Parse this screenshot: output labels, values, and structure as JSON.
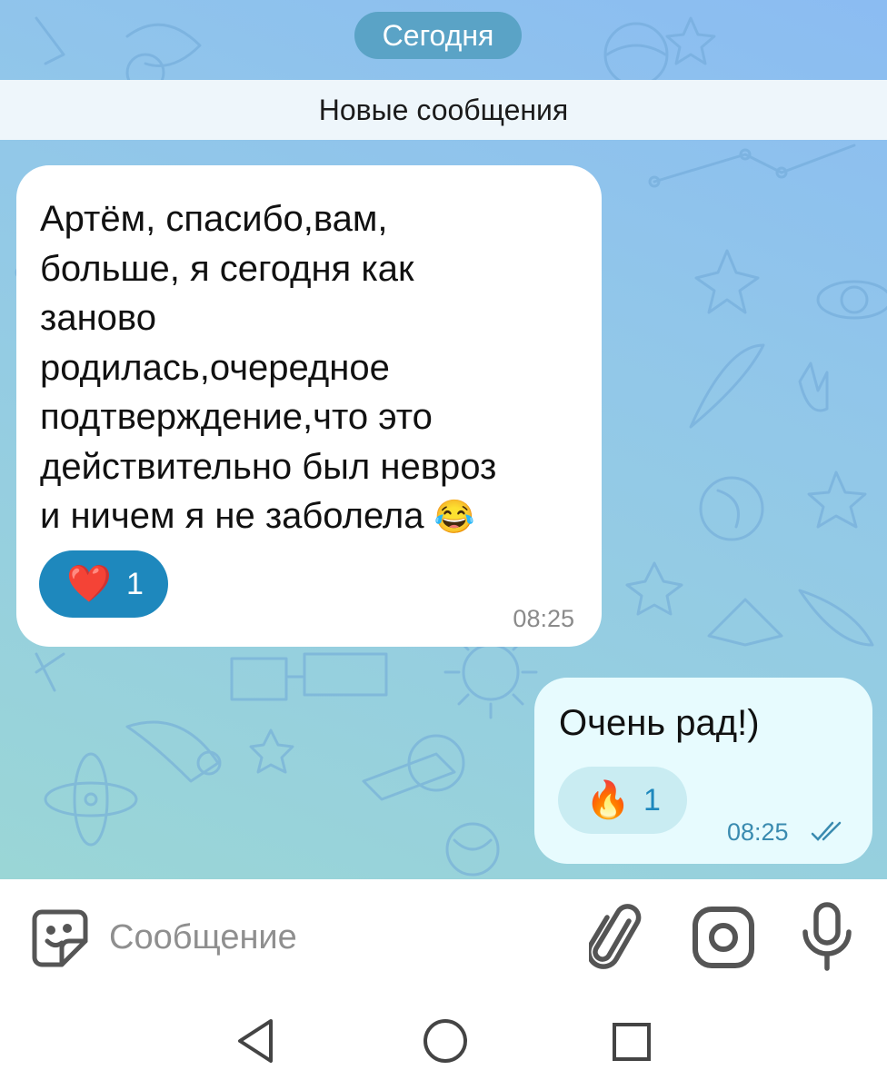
{
  "chat": {
    "date_label": "Сегодня",
    "new_messages_label": "Новые сообщения"
  },
  "messages": [
    {
      "direction": "incoming",
      "lines": [
        "Артём, спасибо,вам,",
        "больше, я сегодня как",
        "заново",
        "родилась,очередное",
        "подтверждение,что это",
        "действительно был невроз",
        "и ничем я не заболела"
      ],
      "trailing_emoji": "😂",
      "reaction": {
        "emoji": "❤️",
        "count": "1"
      },
      "time": "08:25"
    },
    {
      "direction": "outgoing",
      "text": "Очень рад!)",
      "reaction": {
        "emoji": "🔥",
        "count": "1"
      },
      "time": "08:25",
      "status_icon": "double-check-icon"
    }
  ],
  "composer": {
    "placeholder": "Сообщение",
    "icons": [
      "sticker-icon",
      "paperclip-icon",
      "camera-icon",
      "microphone-icon"
    ]
  },
  "system_nav": {
    "icons": [
      "back-icon",
      "home-icon",
      "recents-icon"
    ]
  },
  "colors": {
    "accent": "#1e88bd",
    "incoming_bubble": "#ffffff",
    "outgoing_bubble": "#e7fbfe",
    "date_pill": "#5aa3c6"
  }
}
